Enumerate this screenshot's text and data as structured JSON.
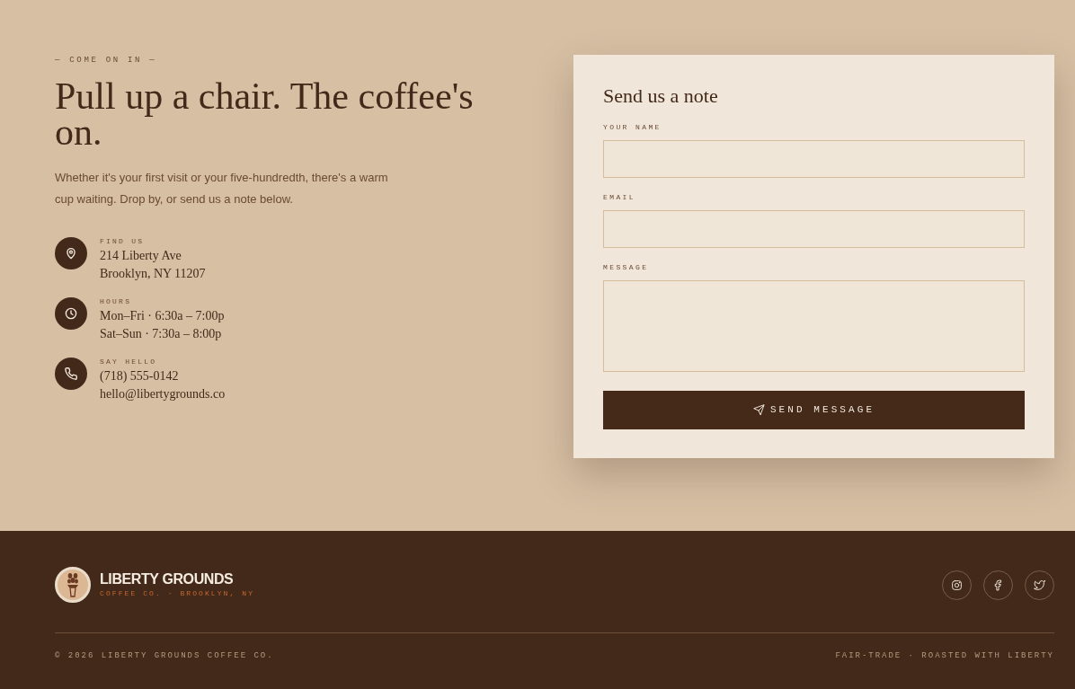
{
  "hero": {
    "eyebrow": "— COME ON IN —",
    "heading": "Pull up a chair. The coffee's on.",
    "intro": "Whether it's your first visit or your five-hundredth, there's a warm cup waiting. Drop by, or send us a note below.",
    "contacts": [
      {
        "kind": "location",
        "label": "FIND US",
        "lines": [
          "214 Liberty Ave",
          "Brooklyn, NY 11207"
        ]
      },
      {
        "kind": "hours",
        "label": "HOURS",
        "lines": [
          "Mon–Fri · 6:30a – 7:00p",
          "Sat–Sun · 7:30a – 8:00p"
        ]
      },
      {
        "kind": "phone",
        "label": "SAY HELLO",
        "lines": [
          "(718) 555-0142",
          "hello@libertygrounds.co"
        ]
      }
    ]
  },
  "form": {
    "title": "Send us a note",
    "fields": [
      {
        "kind": "text",
        "label": "YOUR NAME"
      },
      {
        "kind": "email",
        "label": "EMAIL"
      },
      {
        "kind": "textarea",
        "label": "MESSAGE"
      }
    ],
    "submit": "SEND MESSAGE"
  },
  "footer": {
    "brand": "LIBERTY GROUNDS",
    "tagline": "COFFEE CO. · BROOKLYN, NY",
    "social": [
      {
        "kind": "instagram"
      },
      {
        "kind": "facebook"
      },
      {
        "kind": "twitter"
      }
    ],
    "copyright": "© 2026 LIBERTY GROUNDS COFFEE CO.",
    "motto": "FAIR-TRADE · ROASTED WITH LIBERTY"
  }
}
